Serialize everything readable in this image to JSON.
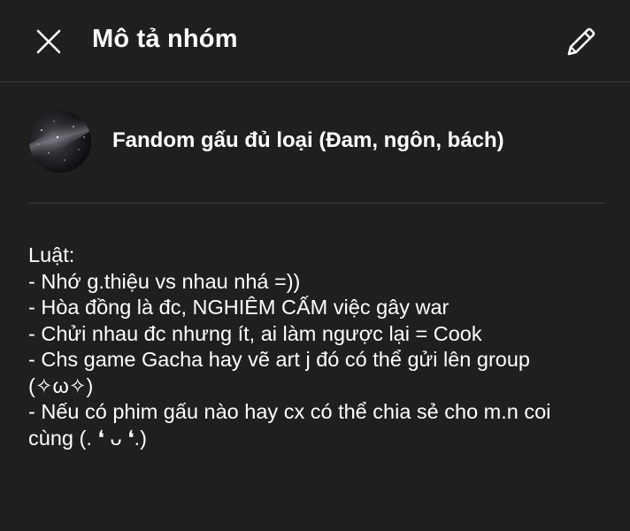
{
  "header": {
    "title": "Mô tả nhóm",
    "close_icon": "close-icon",
    "edit_icon": "pencil-icon"
  },
  "group": {
    "name": "Fandom gấu đủ loại (Đam, ngôn, bách)",
    "avatar": "galaxy-avatar"
  },
  "description": {
    "lines": [
      "Luật:",
      "- Nhớ g.thiệu vs nhau nhá =))",
      "- Hòa đồng là đc, NGHIÊM CẤM việc gây war",
      "- Chửi nhau đc nhưng ít, ai làm ngược lại = Cook",
      "- Chs game Gacha hay vẽ art j đó có thể gửi lên group",
      "(✧ω✧)",
      "- Nếu có phim gấu nào hay cx có thể chia sẻ cho m.n coi",
      "cùng (. ❛ ᴗ ❛.)"
    ]
  },
  "colors": {
    "background": "#1f1f1f",
    "divider": "#3a3a3a",
    "text": "#ffffff"
  }
}
